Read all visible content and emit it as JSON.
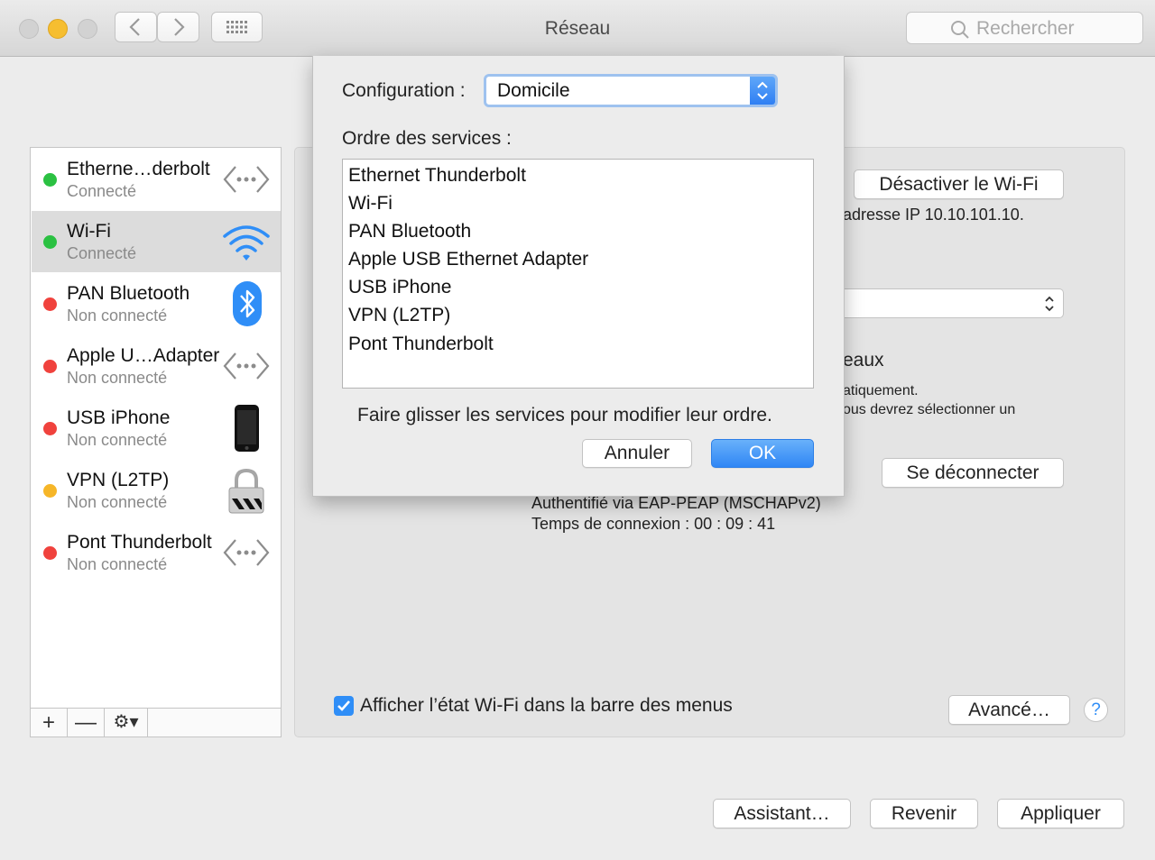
{
  "window": {
    "title": "Réseau"
  },
  "toolbar": {
    "search_placeholder": "Rechercher",
    "grid_icon": "grid-icon",
    "back_icon": "chevron-left-icon",
    "forward_icon": "chevron-right-icon"
  },
  "colors": {
    "connected": "#2bc142",
    "disconnected": "#f0423d",
    "pending": "#f6b628",
    "accent": "#2f8ef7",
    "selected_row": "#dcdcdc"
  },
  "services": [
    {
      "name": "Etherne…derbolt",
      "status": "Connecté",
      "state": "connected",
      "icon": "ethernet-icon"
    },
    {
      "name": "Wi-Fi",
      "status": "Connecté",
      "state": "connected",
      "icon": "wifi-icon",
      "selected": true
    },
    {
      "name": "PAN Bluetooth",
      "status": "Non connecté",
      "state": "disconnected",
      "icon": "bluetooth-icon"
    },
    {
      "name": "Apple U…Adapter",
      "status": "Non connecté",
      "state": "disconnected",
      "icon": "ethernet-icon"
    },
    {
      "name": "USB iPhone",
      "status": "Non connecté",
      "state": "disconnected",
      "icon": "iphone-icon"
    },
    {
      "name": "VPN (L2TP)",
      "status": "Non connecté",
      "state": "pending",
      "icon": "lock-icon"
    },
    {
      "name": "Pont Thunderbolt",
      "status": "Non connecté",
      "state": "disconnected",
      "icon": "ethernet-icon"
    }
  ],
  "sidebar_toolbar": {
    "add": "+",
    "remove": "—",
    "gear": "⚙▾"
  },
  "panel": {
    "wifi_toggle_button": "Désactiver le Wi-Fi",
    "ip_text": "adresse IP 10.10.101.10.",
    "networks_text": "eaux",
    "auto_text": "atiquement.",
    "select_text": "ous devrez sélectionner un",
    "disconnect_button": "Se déconnecter",
    "auth_text": "Authentifié via EAP-PEAP (MSCHAPv2)",
    "time_text": "Temps de connexion : 00 : 09 : 41",
    "show_wifi_checkbox": "Afficher l’état Wi-Fi dans la barre des menus",
    "advanced_button": "Avancé…",
    "help": "?"
  },
  "bottom": {
    "assistant": "Assistant…",
    "revert": "Revenir",
    "apply": "Appliquer"
  },
  "sheet": {
    "config_label": "Configuration :",
    "config_value": "Domicile",
    "order_label": "Ordre des services :",
    "order_items": [
      "Ethernet Thunderbolt",
      "Wi-Fi",
      "PAN Bluetooth",
      "Apple USB Ethernet Adapter",
      "USB iPhone",
      "VPN (L2TP)",
      "Pont Thunderbolt"
    ],
    "hint": "Faire glisser les services pour modifier leur ordre.",
    "cancel": "Annuler",
    "ok": "OK"
  }
}
